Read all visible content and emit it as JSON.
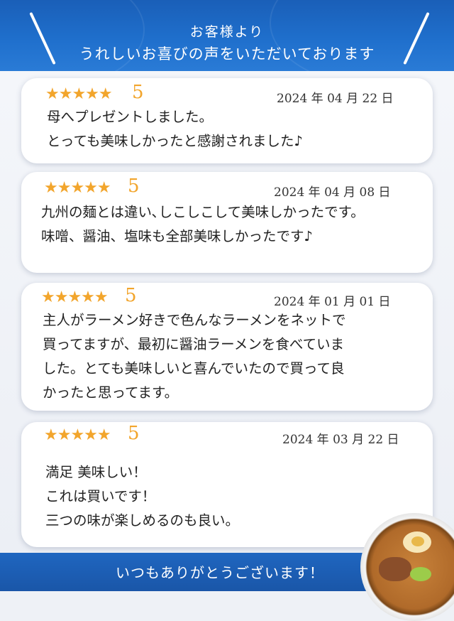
{
  "header": {
    "line1": "お客様より",
    "line2": "うれしいお喜びの声をいただいております"
  },
  "reviews": [
    {
      "stars": "★★★★★",
      "rating": "5",
      "date": "2024 年 04 月 22 日",
      "text": "母へプレゼントしました。\nとっても美味しかったと感謝されました♪"
    },
    {
      "stars": "★★★★★",
      "rating": "5",
      "date": "2024 年 04 月 08 日",
      "text": "九州の麺とは違い､しこしこして美味しかったです。\n味噌、醤油、塩味も全部美味しかったです♪"
    },
    {
      "stars": "★★★★★",
      "rating": "5",
      "date": "2024 年 01 月 01 日",
      "text": "主人がラーメン好きで色んなラーメンをネットで\n買ってますが、最初に醤油ラーメンを食べていま\nした。とても美味しいと喜んでいたので買って良\nかったと思ってます。"
    },
    {
      "stars": "★★★★★",
      "rating": "5",
      "date": "2024 年 03 月 22 日",
      "text": "満足 美味しい！\nこれは買いです！\n三つの味が楽しめるのも良い。"
    }
  ],
  "footer": {
    "text": "いつもありがとうございます！"
  },
  "colors": {
    "header_blue": "#1f6fcc",
    "star_orange": "#f2a52c",
    "footer_blue": "#1a56a8"
  }
}
